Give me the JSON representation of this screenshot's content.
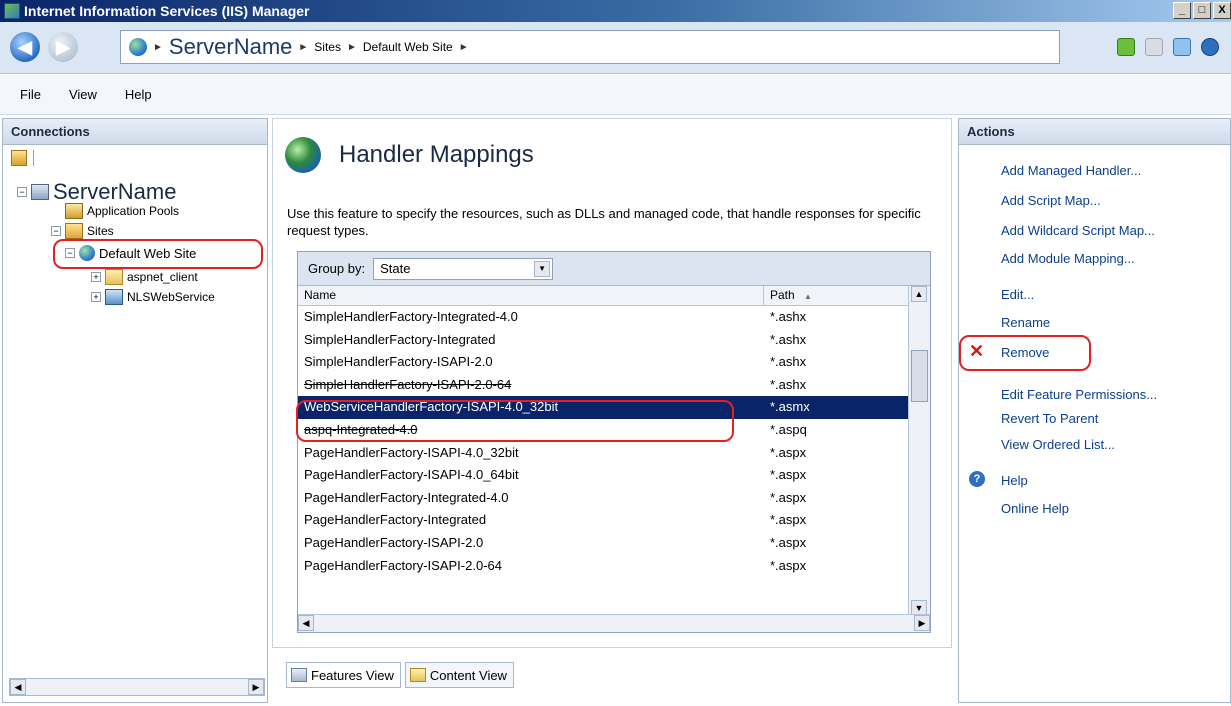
{
  "window": {
    "title": "Internet Information Services (IIS) Manager",
    "minimize": "_",
    "maximize": "□",
    "close": "X"
  },
  "address": {
    "back": "◀",
    "forward": "▶",
    "crumbs": [
      "ServerName",
      "Sites",
      "Default Web Site"
    ],
    "sep": "►"
  },
  "menu": {
    "file": "File",
    "view": "View",
    "help": "Help"
  },
  "connections": {
    "title": "Connections",
    "tree": {
      "server": "ServerName",
      "app_pools": "Application Pools",
      "sites": "Sites",
      "default_site": "Default Web Site",
      "aspnet_client": "aspnet_client",
      "nlswebservice": "NLSWebService"
    }
  },
  "feature": {
    "title": "Handler Mappings",
    "description": "Use this feature to specify the resources, such as DLLs and managed code, that handle responses for specific request types.",
    "group_by_label": "Group by:",
    "group_by_value": "State",
    "col_name": "Name",
    "col_path": "Path",
    "sort_arrow": "▲",
    "rows": [
      {
        "name": "SimpleHandlerFactory-Integrated-4.0",
        "path": "*.ashx"
      },
      {
        "name": "SimpleHandlerFactory-Integrated",
        "path": "*.ashx"
      },
      {
        "name": "SimpleHandlerFactory-ISAPI-2.0",
        "path": "*.ashx"
      },
      {
        "name": "SimpleHandlerFactory-ISAPI-2.0-64",
        "path": "*.ashx"
      },
      {
        "name": "WebServiceHandlerFactory-ISAPI-4.0_32bit",
        "path": "*.asmx"
      },
      {
        "name": "aspq-Integrated-4.0",
        "path": "*.aspq"
      },
      {
        "name": "PageHandlerFactory-ISAPI-4.0_32bit",
        "path": "*.aspx"
      },
      {
        "name": "PageHandlerFactory-ISAPI-4.0_64bit",
        "path": "*.aspx"
      },
      {
        "name": "PageHandlerFactory-Integrated-4.0",
        "path": "*.aspx"
      },
      {
        "name": "PageHandlerFactory-Integrated",
        "path": "*.aspx"
      },
      {
        "name": "PageHandlerFactory-ISAPI-2.0",
        "path": "*.aspx"
      },
      {
        "name": "PageHandlerFactory-ISAPI-2.0-64",
        "path": "*.aspx"
      }
    ],
    "features_view": "Features View",
    "content_view": "Content View"
  },
  "actions": {
    "title": "Actions",
    "add_managed_handler": "Add Managed Handler...",
    "add_script_map": "Add Script Map...",
    "add_wildcard_script_map": "Add Wildcard Script Map...",
    "add_module_mapping": "Add Module Mapping...",
    "edit": "Edit...",
    "rename": "Rename",
    "remove": "Remove",
    "edit_feature_permissions": "Edit Feature Permissions...",
    "revert_to_parent": "Revert To Parent",
    "view_ordered_list": "View Ordered List...",
    "help": "Help",
    "online_help": "Online Help"
  },
  "colors": {
    "highlight": "#e52020",
    "selection": "#0a246a",
    "link": "#0b3f8f"
  }
}
